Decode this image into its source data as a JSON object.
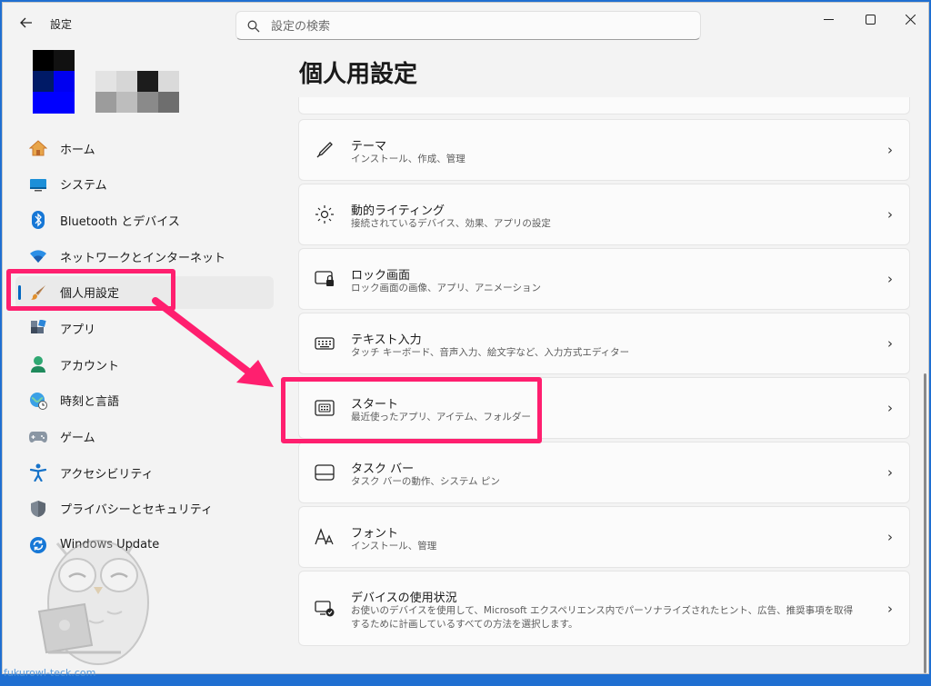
{
  "titlebar": {
    "app_title": "設定",
    "search_placeholder": "設定の検索"
  },
  "sidebar": {
    "items": [
      {
        "label": "ホーム",
        "icon": "home-icon"
      },
      {
        "label": "システム",
        "icon": "system-icon"
      },
      {
        "label": "Bluetooth とデバイス",
        "icon": "bluetooth-icon"
      },
      {
        "label": "ネットワークとインターネット",
        "icon": "wifi-icon"
      },
      {
        "label": "個人用設定",
        "icon": "brush-icon",
        "active": true
      },
      {
        "label": "アプリ",
        "icon": "apps-icon"
      },
      {
        "label": "アカウント",
        "icon": "account-icon"
      },
      {
        "label": "時刻と言語",
        "icon": "time-language-icon"
      },
      {
        "label": "ゲーム",
        "icon": "gamepad-icon"
      },
      {
        "label": "アクセシビリティ",
        "icon": "accessibility-icon"
      },
      {
        "label": "プライバシーとセキュリティ",
        "icon": "shield-icon"
      },
      {
        "label": "Windows Update",
        "icon": "update-icon"
      }
    ]
  },
  "main": {
    "page_title": "個人用設定",
    "cards": [
      {
        "title": "テーマ",
        "subtitle": "インストール、作成、管理",
        "icon": "brush-pen-icon"
      },
      {
        "title": "動的ライティング",
        "subtitle": "接続されているデバイス、効果、アプリの設定",
        "icon": "lighting-icon"
      },
      {
        "title": "ロック画面",
        "subtitle": "ロック画面の画像、アプリ、アニメーション",
        "icon": "lock-screen-icon"
      },
      {
        "title": "テキスト入力",
        "subtitle": "タッチ キーボード、音声入力、絵文字など、入力方式エディター",
        "icon": "keyboard-icon"
      },
      {
        "title": "スタート",
        "subtitle": "最近使ったアプリ、アイテム、フォルダー",
        "icon": "start-menu-icon"
      },
      {
        "title": "タスク バー",
        "subtitle": "タスク バーの動作、システム ピン",
        "icon": "taskbar-icon"
      },
      {
        "title": "フォント",
        "subtitle": "インストール、管理",
        "icon": "font-icon"
      },
      {
        "title": "デバイスの使用状況",
        "subtitle": "お使いのデバイスを使用して、Microsoft エクスペリエンス内でパーソナライズされたヒント、広告、推奨事項を取得するために計画しているすべての方法を選択します。",
        "icon": "device-usage-icon"
      }
    ]
  },
  "watermark": "fukurowl-teck.com",
  "colors": {
    "highlight": "#ff1f6f",
    "accent": "#0067c0"
  }
}
